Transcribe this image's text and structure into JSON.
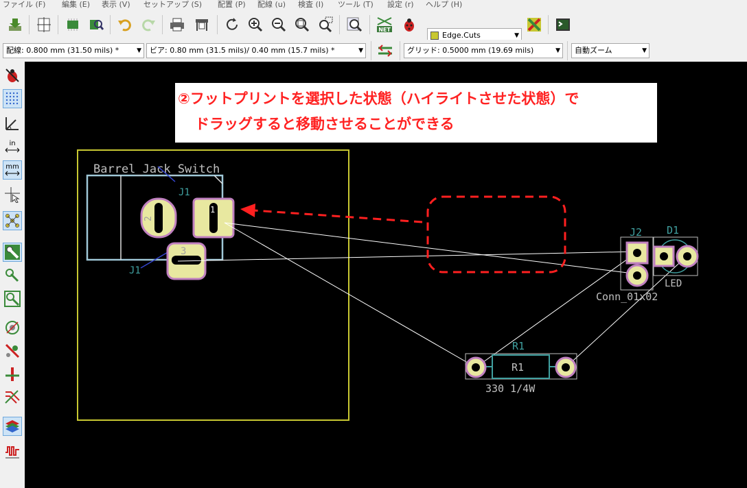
{
  "menu": [
    "ファイル (F)",
    "編集 (E)",
    "表示 (V)",
    "セットアップ (S)",
    "配置 (P)",
    "配線 (u)",
    "検査 (I)",
    "ツール (T)",
    "設定 (r)",
    "ヘルプ (H)"
  ],
  "toolbar": {
    "layer_select": "Edge.Cuts",
    "net_label": "NET"
  },
  "toolbar2": {
    "track_width": "配線: 0.800 mm (31.50 mils) *",
    "via_size": "ビア: 0.80 mm (31.5 mils)/ 0.40 mm (15.7 mils) *",
    "grid": "グリッド: 0.5000 mm (19.69 mils)",
    "zoom": "自動ズーム"
  },
  "left_tools": {
    "in_label": "in",
    "mm_label": "mm"
  },
  "annotation": {
    "line1": "②フットプリントを選択した状態（ハイライトさせた状態）で",
    "line2": "ドラッグすると移動させることができる"
  },
  "pcb": {
    "j1_value": "Barrel_Jack_Switch",
    "j1_ref": "J1",
    "j1_ref_bottom": "J1",
    "j1_pad1": "1",
    "j1_pad2": "2",
    "j1_pad3": "3",
    "j2_ref": "J2",
    "j2_value": "Conn_01x02",
    "d1_ref": "D1",
    "d1_value": "LED",
    "r1_ref": "R1",
    "r1_body": "R1",
    "r1_value": "330 1/4W"
  },
  "colors": {
    "board_edge": "#c8c832",
    "courtyard": "#a0c8d8",
    "pad_fill": "#e8e8a0",
    "pad_ring": "#c080c0",
    "ratsnest": "#ffffff",
    "arrow": "#ff2020",
    "footprint_text": "#40a0a0",
    "silk_text": "#c0c0c0"
  }
}
